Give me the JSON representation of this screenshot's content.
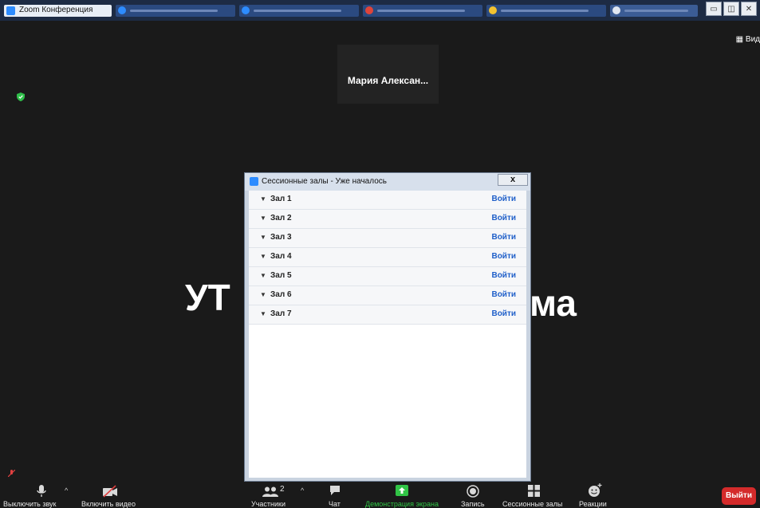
{
  "window": {
    "active_tab": "Zoom Конференция",
    "window_controls": [
      "minimize",
      "restore",
      "close"
    ]
  },
  "meeting": {
    "speaker_name": "Мария Алексан...",
    "view_label": "Вид",
    "shared_text_left": "УТ",
    "shared_text_right": "ма"
  },
  "breakout_dialog": {
    "title": "Сессионные залы - Уже началось",
    "close_label": "x",
    "rooms": [
      {
        "name": "Зал 1",
        "action": "Войти"
      },
      {
        "name": "Зал 2",
        "action": "Войти"
      },
      {
        "name": "Зал 3",
        "action": "Войти"
      },
      {
        "name": "Зал 4",
        "action": "Войти"
      },
      {
        "name": "Зал 5",
        "action": "Войти"
      },
      {
        "name": "Зал 6",
        "action": "Войти"
      },
      {
        "name": "Зал 7",
        "action": "Войти"
      }
    ]
  },
  "toolbar": {
    "mute_label": "Выключить звук",
    "video_label": "Включить видео",
    "participants_label": "Участники",
    "participants_count": "2",
    "chat_label": "Чат",
    "share_label": "Демонстрация экрана",
    "record_label": "Запись",
    "breakout_label": "Сессионные залы",
    "reactions_label": "Реакции",
    "leave_label": "Выйти"
  },
  "colors": {
    "share_green": "#31c446",
    "leave_red": "#d42b2b",
    "link_blue": "#1f5fc9",
    "zoom_blue": "#2d8cff"
  }
}
